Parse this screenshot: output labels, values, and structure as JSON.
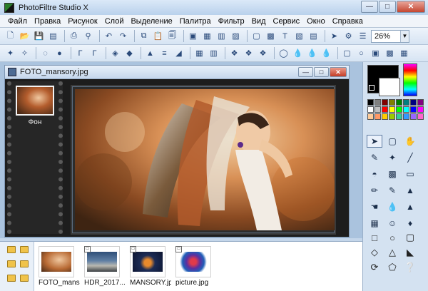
{
  "window": {
    "title": "PhotoFiltre Studio X"
  },
  "menu": [
    "Файл",
    "Правка",
    "Рисунок",
    "Слой",
    "Выделение",
    "Палитра",
    "Фильтр",
    "Вид",
    "Сервис",
    "Окно",
    "Справка"
  ],
  "toolbar": {
    "zoom": "26%"
  },
  "document": {
    "name": "FOTO_mansory.jpg",
    "layer_label": "Фон"
  },
  "palette_colors": [
    "#000000",
    "#808080",
    "#800000",
    "#808000",
    "#008000",
    "#008080",
    "#000080",
    "#800080",
    "#ffffff",
    "#c0c0c0",
    "#ff0000",
    "#ffff00",
    "#00ff00",
    "#00ffff",
    "#0000ff",
    "#ff00ff",
    "#ffcc99",
    "#ff9966",
    "#ffcc00",
    "#99cc00",
    "#33cc99",
    "#3399ff",
    "#9966ff",
    "#ff66cc"
  ],
  "thumbnails": [
    {
      "label": "FOTO_manso...",
      "art_color": "#b86a34"
    },
    {
      "label": "HDR_2017...",
      "art_color": "#5f7fa4"
    },
    {
      "label": "MANSORY.jpg",
      "art_color": "#1b2b55"
    },
    {
      "label": "picture.jpg",
      "art_color": "#5b2fa0"
    }
  ]
}
